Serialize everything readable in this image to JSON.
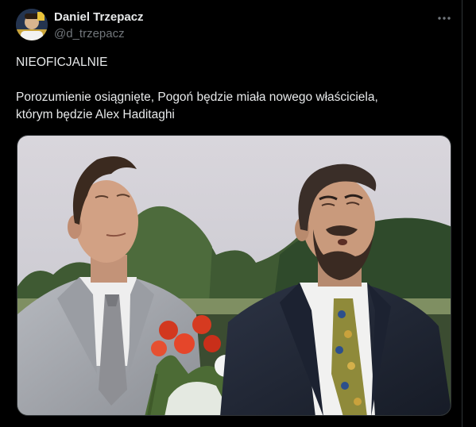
{
  "author": {
    "display_name": "Daniel Trzepacz",
    "handle": "@d_trzepacz",
    "avatar_icon": "avatar-photo"
  },
  "header": {
    "more_icon": "more-horizontal-icon"
  },
  "tweet": {
    "line1": "NIEOFICJALNIE",
    "line2": "Porozumienie osiągnięte, Pogoń będzie miała nowego właściciela,",
    "line3": "którym będzie Alex Haditaghi"
  },
  "colors": {
    "background": "#000000",
    "text_primary": "#e7e9ea",
    "text_secondary": "#71767b",
    "border": "#2f3336"
  }
}
